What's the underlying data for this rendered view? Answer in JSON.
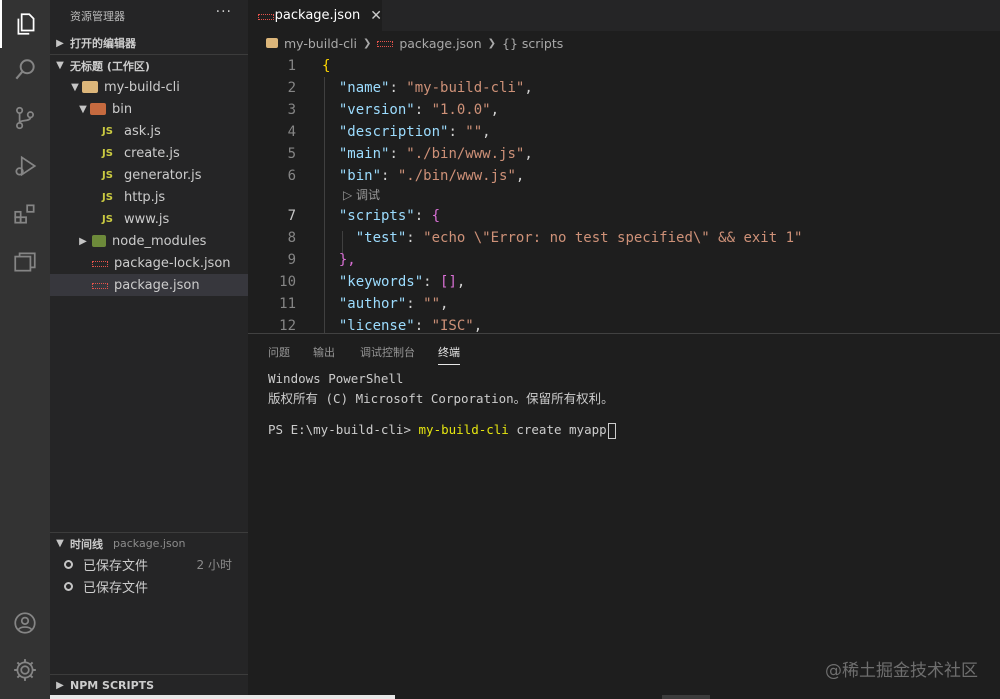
{
  "sidebar": {
    "title": "资源管理器",
    "more": "···",
    "open_editors": "打开的编辑器",
    "workspace": "无标题 (工作区)",
    "tree": [
      {
        "label": "my-build-cli",
        "type": "folder-root"
      },
      {
        "label": "bin",
        "type": "folder"
      },
      {
        "label": "ask.js",
        "type": "js"
      },
      {
        "label": "create.js",
        "type": "js"
      },
      {
        "label": "generator.js",
        "type": "js"
      },
      {
        "label": "http.js",
        "type": "js"
      },
      {
        "label": "www.js",
        "type": "js"
      },
      {
        "label": "node_modules",
        "type": "folder"
      },
      {
        "label": "package-lock.json",
        "type": "json"
      },
      {
        "label": "package.json",
        "type": "json"
      }
    ],
    "js_badge": "JS",
    "timeline": {
      "title": "时间线",
      "file": "package.json",
      "items": [
        {
          "label": "已保存文件",
          "time": "2 小时"
        },
        {
          "label": "已保存文件",
          "time": ""
        }
      ]
    },
    "npm_scripts": "NPM SCRIPTS"
  },
  "tab": {
    "label": "package.json",
    "close": "✕"
  },
  "breadcrumb": [
    "my-build-cli",
    "package.json",
    "{} scripts"
  ],
  "editor": {
    "line_numbers": [
      "1",
      "2",
      "3",
      "4",
      "5",
      "6",
      "7",
      "8",
      "9",
      "10",
      "11",
      "12"
    ],
    "codelens": "调试",
    "lines": {
      "l1": "{",
      "l2k": "\"name\"",
      "l2v": "\"my-build-cli\"",
      "l3k": "\"version\"",
      "l3v": "\"1.0.0\"",
      "l4k": "\"description\"",
      "l4v": "\"\"",
      "l5k": "\"main\"",
      "l5v": "\"./bin/www.js\"",
      "l6k": "\"bin\"",
      "l6v": "\"./bin/www.js\"",
      "l7k": "\"scripts\"",
      "l7b": "{",
      "l8k": "\"test\"",
      "l8v": "\"echo \\\"Error: no test specified\\\" && exit 1\"",
      "l9": "},",
      "l10k": "\"keywords\"",
      "l10v": "[]",
      "l11k": "\"author\"",
      "l11v": "\"\"",
      "l12k": "\"license\"",
      "l12v": "\"ISC\""
    }
  },
  "panel": {
    "tabs": [
      "问题",
      "输出",
      "调试控制台",
      "终端"
    ],
    "terminal": {
      "line1": "Windows PowerShell",
      "line2": "版权所有 (C) Microsoft Corporation。保留所有权利。",
      "prompt": "PS E:\\my-build-cli> ",
      "cmd": "my-build-cli",
      "args": " create myapp"
    }
  },
  "watermark": "@稀土掘金技术社区",
  "colors": {
    "activity_bar": "#333333",
    "sidebar": "#252526",
    "editor": "#1e1e1e",
    "json_key": "#9cdcfe",
    "json_string": "#ce9178",
    "terminal_yellow": "#e5e510"
  }
}
